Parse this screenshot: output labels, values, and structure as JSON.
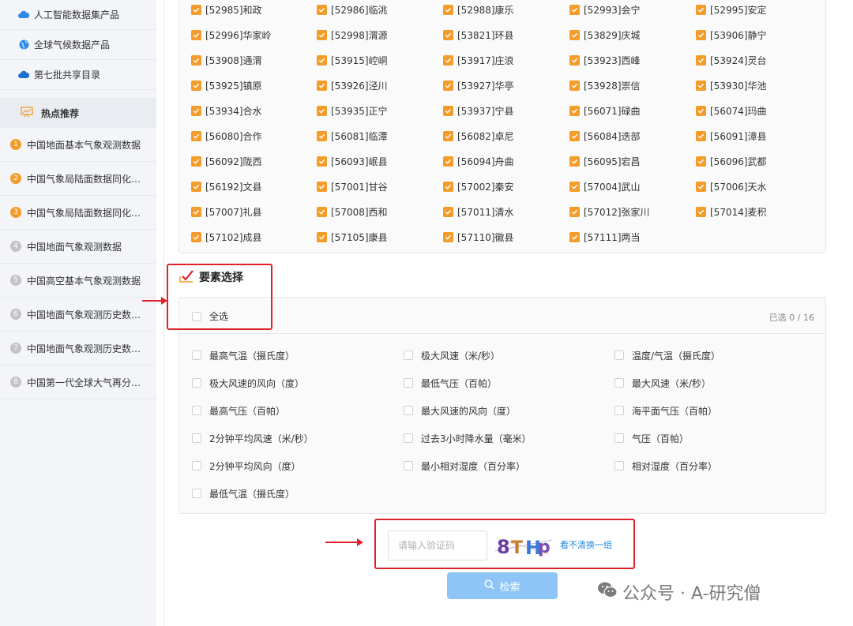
{
  "sidebar": {
    "top_items": [
      {
        "label": "人工智能数据集产品",
        "icon": "ai-cloud-icon"
      },
      {
        "label": "全球气候数据产品",
        "icon": "globe-icon"
      },
      {
        "label": "第七批共享目录",
        "icon": "cloud-icon"
      }
    ],
    "hot_title": "热点推荐",
    "hot_items": [
      {
        "rank": "1",
        "label": "中国地面基本气象观测数据",
        "color": "#f39c29"
      },
      {
        "rank": "2",
        "label": "中国气象局陆面数据同化系...",
        "color": "#f39c29"
      },
      {
        "rank": "3",
        "label": "中国气象局陆面数据同化系...",
        "color": "#f39c29"
      },
      {
        "rank": "4",
        "label": "中国地面气象观测数据",
        "color": "#c4c4c4"
      },
      {
        "rank": "5",
        "label": "中国高空基本气象观测数据",
        "color": "#c4c4c4"
      },
      {
        "rank": "6",
        "label": "中国地面气象观测历史数据...",
        "color": "#c4c4c4"
      },
      {
        "rank": "7",
        "label": "中国地面气象观测历史数据...",
        "color": "#c4c4c4"
      },
      {
        "rank": "8",
        "label": "中国第一代全球大气再分析...",
        "color": "#c4c4c4"
      }
    ]
  },
  "stations": [
    "[52985]和政",
    "[52986]临洮",
    "[52988]康乐",
    "[52993]会宁",
    "[52995]安定",
    "[52996]华家岭",
    "[52998]渭源",
    "[53821]环县",
    "[53829]庆城",
    "[53906]静宁",
    "[53908]通渭",
    "[53915]崆峒",
    "[53917]庄浪",
    "[53923]西峰",
    "[53924]灵台",
    "[53925]镇原",
    "[53926]泾川",
    "[53927]华亭",
    "[53928]崇信",
    "[53930]华池",
    "[53934]合水",
    "[53935]正宁",
    "[53937]宁县",
    "[56071]碌曲",
    "[56074]玛曲",
    "[56080]合作",
    "[56081]临潭",
    "[56082]卓尼",
    "[56084]迭部",
    "[56091]漳县",
    "[56092]陇西",
    "[56093]岷县",
    "[56094]舟曲",
    "[56095]宕昌",
    "[56096]武都",
    "[56192]文县",
    "[57001]甘谷",
    "[57002]秦安",
    "[57004]武山",
    "[57006]天水",
    "[57007]礼县",
    "[57008]西和",
    "[57011]清水",
    "[57012]张家川",
    "[57014]麦积",
    "[57102]成县",
    "[57105]康县",
    "[57110]徽县",
    "[57111]两当"
  ],
  "elements": {
    "title": "要素选择",
    "select_all": "全选",
    "selected_count": "已选 0 / 16",
    "items": [
      "最高气温（摄氏度）",
      "极大风速（米/秒）",
      "温度/气温（摄氏度）",
      "极大风速的风向（度）",
      "最低气压（百帕）",
      "最大风速（米/秒）",
      "最高气压（百帕）",
      "最大风速的风向（度）",
      "海平面气压（百帕）",
      "2分钟平均风速（米/秒）",
      "过去3小时降水量（毫米）",
      "气压（百帕）",
      "2分钟平均风向（度）",
      "最小相对湿度（百分率）",
      "相对湿度（百分率）",
      "最低气温（摄氏度）"
    ]
  },
  "captcha": {
    "placeholder": "请输入验证码",
    "text": "8THp",
    "refresh_label": "看不清换一组"
  },
  "search_label": "检索",
  "watermark": "公众号 · A-研究僧",
  "colors": {
    "accent": "#f39c29",
    "highlight": "#e0212a",
    "link": "#1e88e5",
    "button": "#8ec5f6"
  }
}
